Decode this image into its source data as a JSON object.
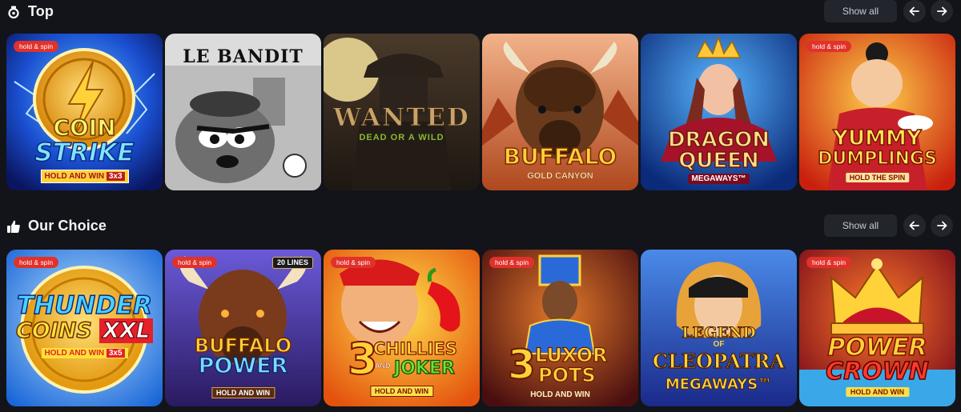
{
  "sections": {
    "top": {
      "title": "Top",
      "show_all": "Show all"
    },
    "choice": {
      "title": "Our Choice",
      "show_all": "Show all"
    }
  },
  "top_games": [
    {
      "title_a": "COIN",
      "title_b": "STRIKE",
      "sub": "HOLD AND WIN",
      "sub2": "3x3",
      "badge": "hold & spin"
    },
    {
      "title_a": "LE BANDIT"
    },
    {
      "title_a": "WANTED",
      "sub": "DEAD OR A WILD"
    },
    {
      "title_a": "BUFFALO",
      "sub": "GOLD CANYON"
    },
    {
      "title_a": "DRAGON",
      "title_b": "QUEEN",
      "sub": "MEGAWAYS™"
    },
    {
      "title_a": "YUMMY",
      "title_b": "DUMPLINGS",
      "sub": "HOLD THE SPIN",
      "badge": "hold & spin"
    }
  ],
  "choice_games": [
    {
      "title_a": "THUNDER",
      "title_b": "COINS",
      "title_c": "XXL",
      "sub": "HOLD AND WIN",
      "sub2": "3x5",
      "badge": "hold & spin"
    },
    {
      "title_a": "BUFFALO",
      "title_b": "POWER",
      "sub": "HOLD AND WIN",
      "badge": "hold & spin",
      "tag": "20 LINES"
    },
    {
      "title_num": "3",
      "title_a": "CHILLIES",
      "title_and": "AND",
      "title_b": "JOKER",
      "sub": "HOLD AND WIN",
      "badge": "hold & spin"
    },
    {
      "title_num": "3",
      "title_a": "LUXOR",
      "title_b": "POTS",
      "sub": "HOLD AND WIN",
      "badge": "hold & spin"
    },
    {
      "title_a": "LEGEND",
      "title_of": "OF",
      "title_b": "CLEOPATRA",
      "sub": "MEGAWAYS™"
    },
    {
      "title_a": "POWER",
      "title_b": "CROWN",
      "sub": "HOLD AND WIN",
      "badge": "hold & spin"
    }
  ],
  "colors": {
    "background": "#131419",
    "button": "#23252d",
    "badge": "#e1312b"
  }
}
